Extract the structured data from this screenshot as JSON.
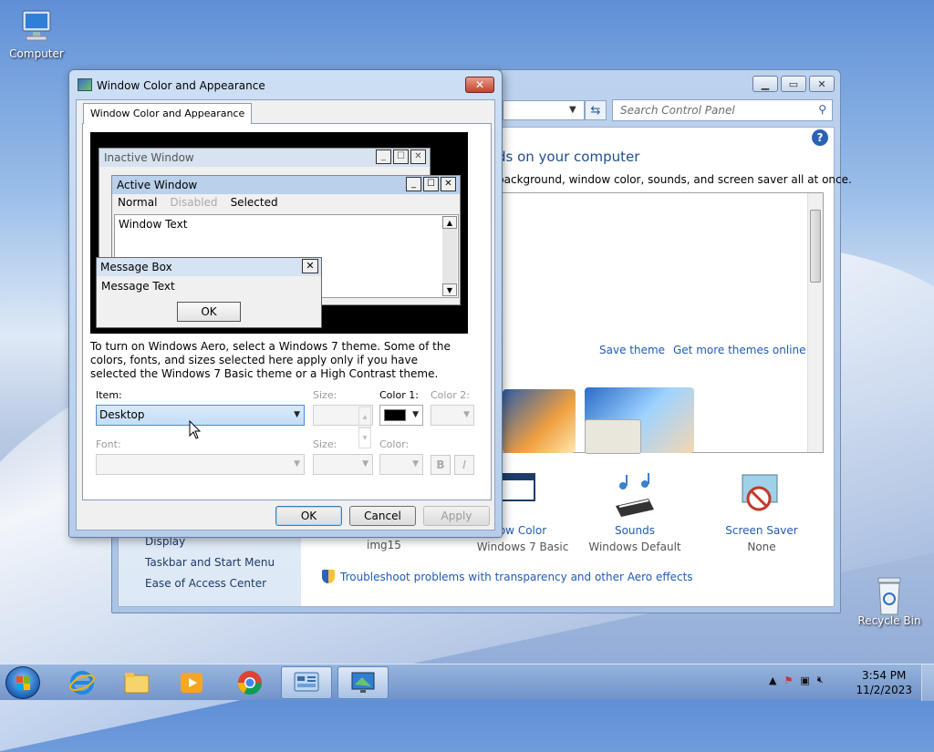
{
  "desktop": {
    "icons": [
      {
        "label": "Computer"
      },
      {
        "label": "Recycle Bin"
      }
    ]
  },
  "control_panel": {
    "search_placeholder": "Search Control Panel",
    "heading": "ds on your computer",
    "subtext": "background, window color, sounds, and screen saver all at once.",
    "save_theme": "Save theme",
    "get_more_themes": "Get more themes online",
    "items": [
      {
        "title": "ow Color",
        "sub": "Windows 7 Basic"
      },
      {
        "title": "Sounds",
        "sub": "Windows Default"
      },
      {
        "title": "Screen Saver",
        "sub": "None"
      }
    ],
    "background_sub": "img15",
    "left_links": [
      "Display",
      "Taskbar and Start Menu",
      "Ease of Access Center"
    ],
    "troubleshoot": "Troubleshoot problems with transparency and other Aero effects"
  },
  "dialog": {
    "title": "Window Color and Appearance",
    "tab_label": "Window Color and Appearance",
    "preview": {
      "inactive_title": "Inactive Window",
      "active_title": "Active Window",
      "menu_normal": "Normal",
      "menu_disabled": "Disabled",
      "menu_selected": "Selected",
      "window_text": "Window Text",
      "msgbox_title": "Message Box",
      "msgbox_text": "Message Text",
      "msgbox_ok": "OK"
    },
    "info_text": "To turn on Windows Aero, select a Windows 7 theme.  Some of the colors, fonts, and sizes selected here apply only if you have selected the Windows 7 Basic theme or a High Contrast theme.",
    "item_label": "Item:",
    "item_value": "Desktop",
    "size_label": "Size:",
    "color1_label": "Color 1:",
    "color2_label": "Color 2:",
    "font_label": "Font:",
    "size2_label": "Size:",
    "color_label": "Color:",
    "bold_label": "B",
    "italic_label": "I",
    "color1_value": "#000000",
    "ok": "OK",
    "cancel": "Cancel",
    "apply": "Apply"
  },
  "taskbar": {
    "time": "3:54 PM",
    "date": "11/2/2023",
    "apps": [
      "internet-explorer",
      "file-explorer",
      "media-player",
      "chrome",
      "control-panel",
      "personalize"
    ]
  }
}
